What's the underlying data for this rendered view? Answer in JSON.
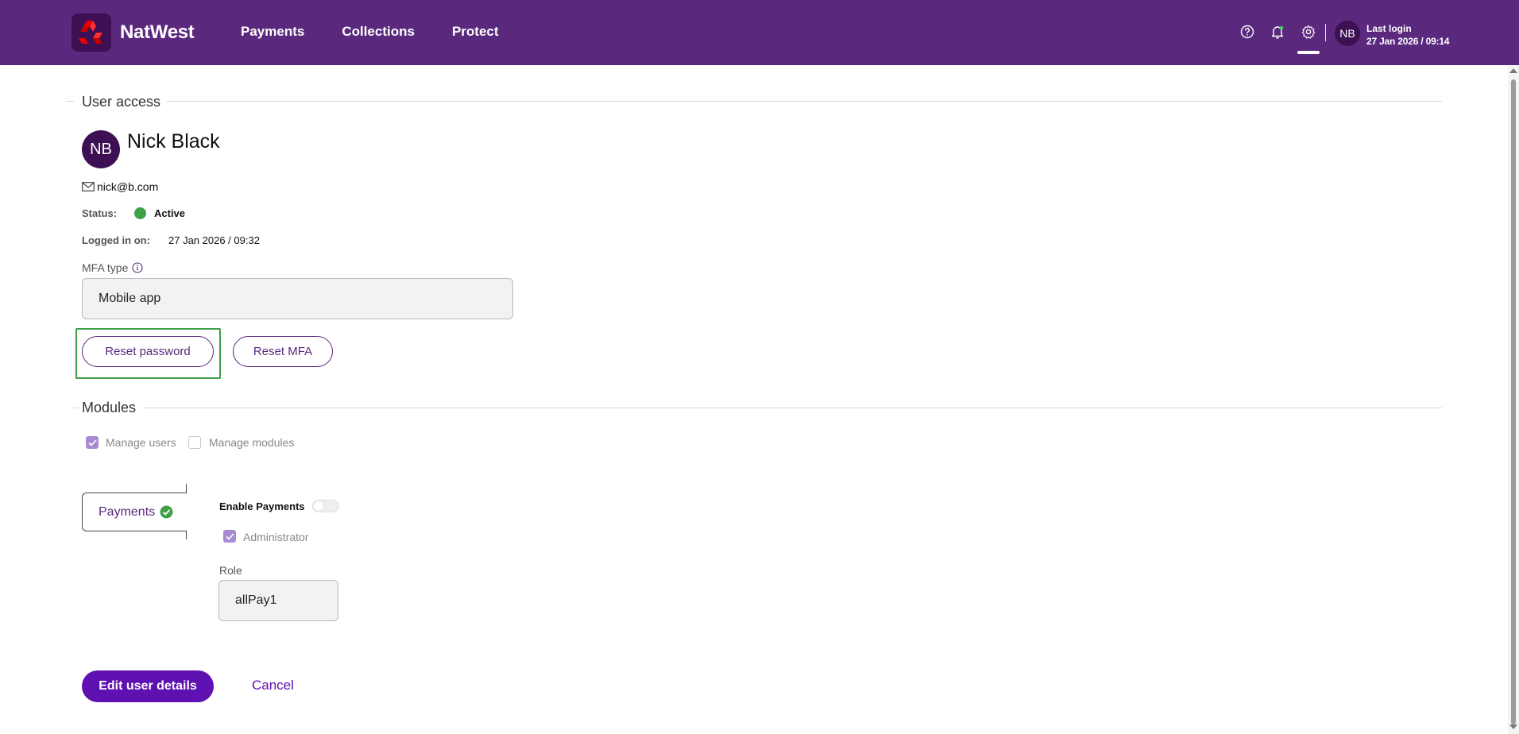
{
  "header": {
    "brand": "NatWest",
    "nav": [
      {
        "label": "Payments"
      },
      {
        "label": "Collections"
      },
      {
        "label": "Protect"
      }
    ],
    "avatar_initials": "NB",
    "last_login_title": "Last login",
    "last_login_date": "27 Jan 2026 / 09:14",
    "icons": [
      "help-icon",
      "bell-icon",
      "gear-icon"
    ]
  },
  "user_access": {
    "section_title": "User access",
    "avatar_initials": "NB",
    "name": "Nick Black",
    "email": "nick@b.com",
    "status_label": "Status:",
    "status_value": "Active",
    "logged_in_label": "Logged in on:",
    "logged_in_value": "27 Jan 2026 / 09:32",
    "mfa_label": "MFA type",
    "mfa_value": "Mobile app",
    "reset_password_label": "Reset password",
    "reset_mfa_label": "Reset MFA"
  },
  "modules": {
    "section_title": "Modules",
    "manage_users_label": "Manage users",
    "manage_users_checked": true,
    "manage_modules_label": "Manage modules",
    "manage_modules_checked": false,
    "tab_label": "Payments",
    "enable_label": "Enable Payments",
    "enable_on": false,
    "administrator_label": "Administrator",
    "administrator_checked": true,
    "role_label": "Role",
    "role_value": "allPay1"
  },
  "footer": {
    "edit_label": "Edit user details",
    "cancel_label": "Cancel"
  },
  "colors": {
    "header_bg": "#5a287d",
    "primary": "#5e10b1",
    "status_active": "#3fa047",
    "highlight": "#3e9b47"
  }
}
